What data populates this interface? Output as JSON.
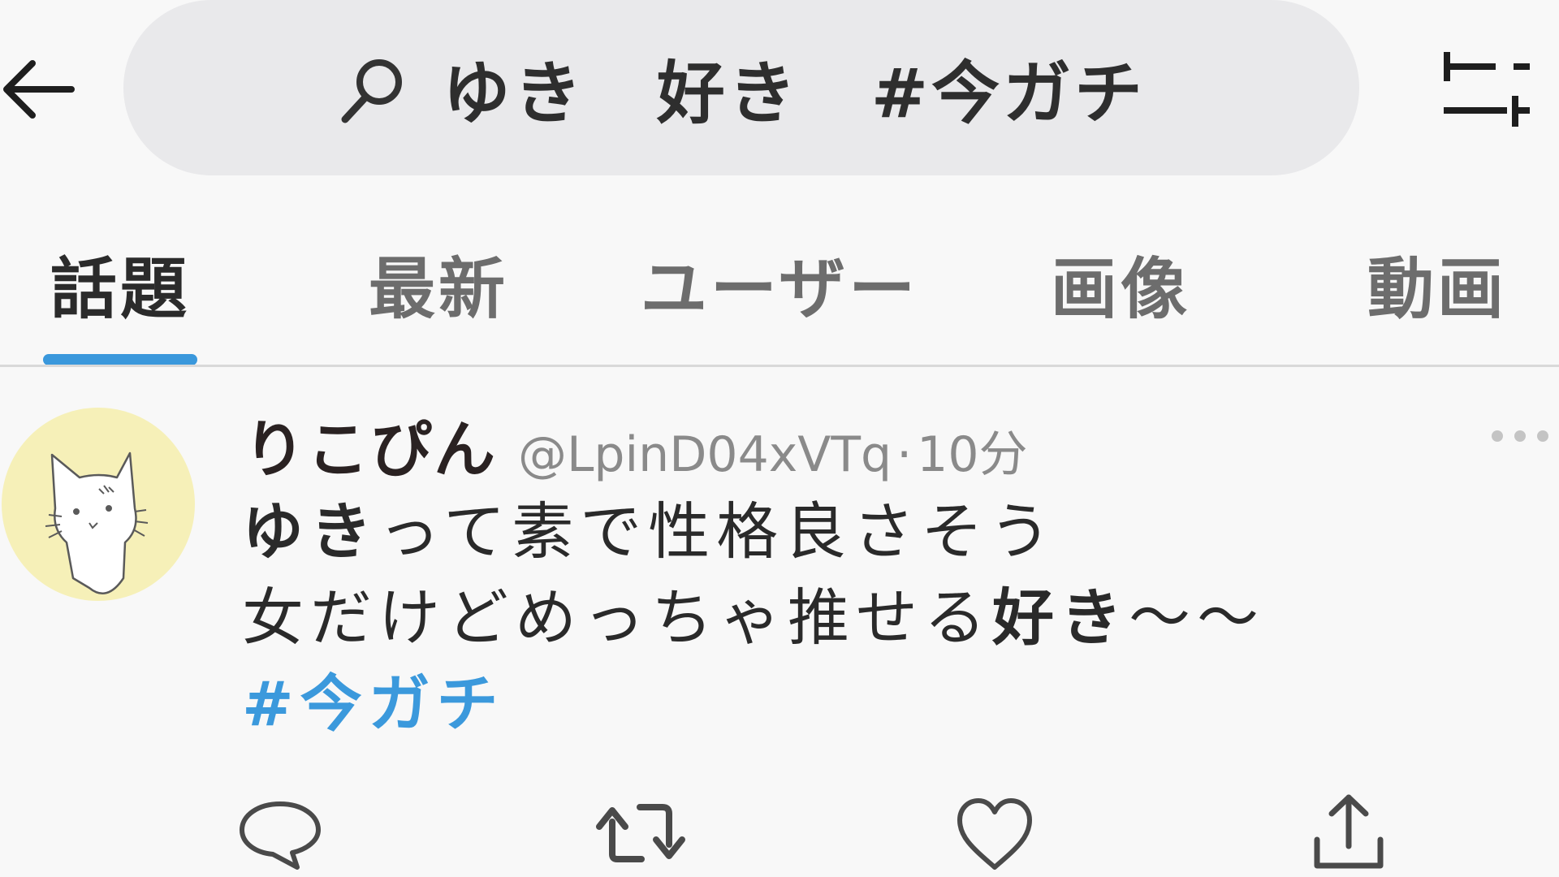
{
  "search": {
    "query": "ゆき　好き　#今ガチ"
  },
  "tabs": [
    {
      "label": "話題",
      "active": true
    },
    {
      "label": "最新",
      "active": false
    },
    {
      "label": "ユーザー",
      "active": false
    },
    {
      "label": "画像",
      "active": false
    },
    {
      "label": "動画",
      "active": false
    }
  ],
  "post": {
    "display_name": "りこぴん",
    "handle": "@LpinD04xVTq",
    "separator": "·",
    "time": "10分",
    "line1_bold": "ゆき",
    "line1_rest": "って素で性格良さそう",
    "line2_start": "女だけどめっちゃ推せる",
    "line2_bold": "好き",
    "line2_end": "〜〜",
    "hashtag": "#今ガチ"
  },
  "icons": {
    "back": "arrow-left-icon",
    "search": "search-icon",
    "filter": "sliders-icon",
    "more": "more-horizontal-icon",
    "reply": "comment-icon",
    "retweet": "retweet-icon",
    "like": "heart-icon",
    "share": "share-icon"
  },
  "colors": {
    "accent": "#3a98dc",
    "search_bg": "#e9e9eb",
    "avatar_bg": "#f6f0b8"
  }
}
